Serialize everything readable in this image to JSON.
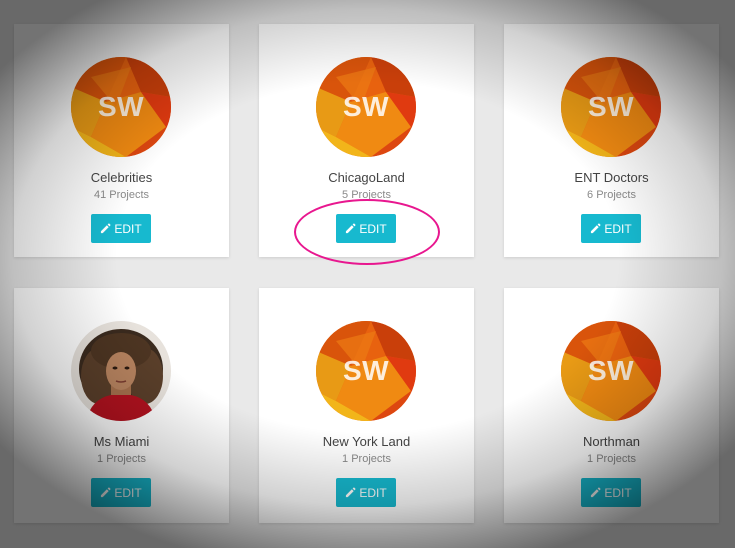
{
  "accent_color": "#17b9cf",
  "annotation_color": "#e8178f",
  "edit_label": "EDIT",
  "cards": [
    {
      "name": "Celebrities",
      "projects": "41 Projects",
      "avatar": "sw-logo",
      "avatar_text": "SW"
    },
    {
      "name": "ChicagoLand",
      "projects": "5 Projects",
      "avatar": "sw-logo",
      "avatar_text": "SW"
    },
    {
      "name": "ENT Doctors",
      "projects": "6 Projects",
      "avatar": "sw-logo",
      "avatar_text": "SW"
    },
    {
      "name": "Ms Miami",
      "projects": "1 Projects",
      "avatar": "photo"
    },
    {
      "name": "New York Land",
      "projects": "1 Projects",
      "avatar": "sw-logo",
      "avatar_text": "SW"
    },
    {
      "name": "Northman",
      "projects": "1 Projects",
      "avatar": "sw-logo",
      "avatar_text": "SW"
    }
  ]
}
